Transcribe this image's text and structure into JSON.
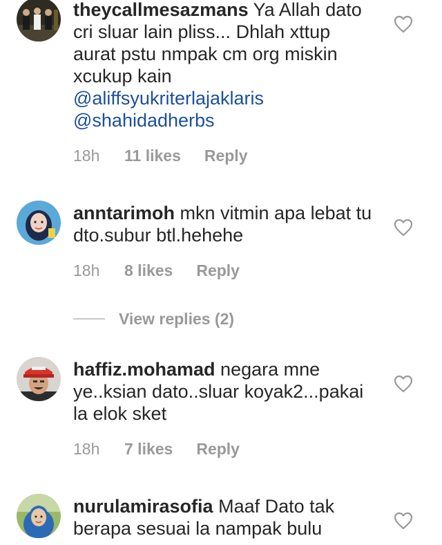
{
  "comments": [
    {
      "username": "theycallmesazmans",
      "text": "Ya Allah dato cri sluar lain pliss... Dhlah xttup aurat pstu nmpak cm org miskin xcukup kain",
      "mentions": [
        "@aliffsyukriterlajaklaris",
        "@shahidadherbs"
      ],
      "time": "18h",
      "likes": "11 likes",
      "reply": "Reply"
    },
    {
      "username": "anntarimoh",
      "text": "mkn vitmin apa lebat tu dto.subur btl.hehehe",
      "time": "18h",
      "likes": "8 likes",
      "reply": "Reply"
    },
    {
      "username": "haffiz.mohamad",
      "text": "negara mne ye..ksian dato..sluar koyak2...pakai la elok sket",
      "time": "18h",
      "likes": "7 likes",
      "reply": "Reply"
    },
    {
      "username": "nurulamirasofia",
      "text": "Maaf Dato tak berapa sesuai la nampak bulu"
    }
  ],
  "view_replies": "View replies (2)",
  "icons": {
    "like": "heart-outline-icon"
  },
  "colors": {
    "text": "#262626",
    "secondary": "#999999",
    "mention": "#1b4f9e"
  }
}
